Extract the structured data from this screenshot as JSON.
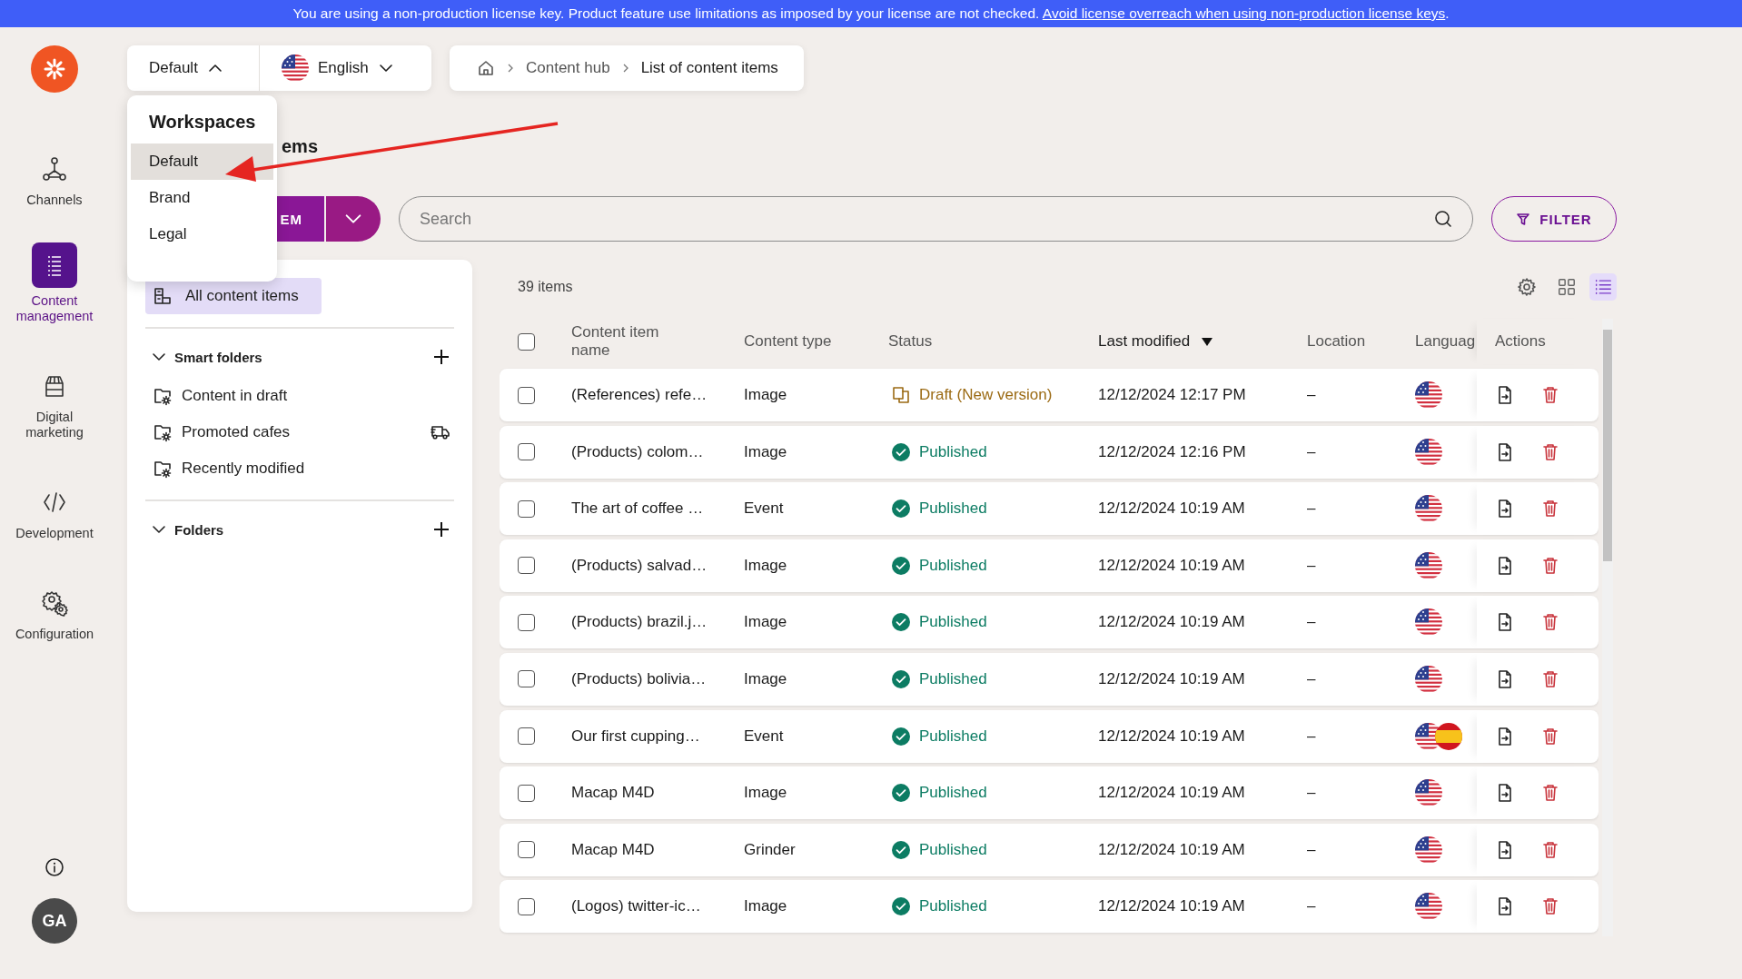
{
  "banner": {
    "text": "You are using a non-production license key. Product feature use limitations as imposed by your license are not checked.",
    "link": "Avoid license overreach when using non-production license keys",
    "after": "."
  },
  "nav": {
    "items": [
      {
        "kind": "channels",
        "label": "Channels",
        "selected": false
      },
      {
        "kind": "content",
        "label": "Content management",
        "selected": true
      },
      {
        "kind": "marketing",
        "label": "Digital marketing",
        "selected": false
      },
      {
        "kind": "development",
        "label": "Development",
        "selected": false
      },
      {
        "kind": "configuration",
        "label": "Configuration",
        "selected": false
      }
    ],
    "avatar": "GA"
  },
  "workspace_switcher": {
    "label": "Default",
    "expanded": true
  },
  "language_switcher": {
    "label": "English",
    "flag": {
      "kind": "us"
    },
    "expanded": false
  },
  "breadcrumb": [
    {
      "kind": "home"
    },
    {
      "kind": "link",
      "label": "Content hub"
    },
    {
      "kind": "current",
      "label": "List of content items"
    }
  ],
  "workspace_menu": {
    "title": "Workspaces",
    "items": [
      {
        "label": "Default",
        "selected": true
      },
      {
        "label": "Brand",
        "selected": false
      },
      {
        "label": "Legal",
        "selected": false
      }
    ]
  },
  "page_title": "ems",
  "new_button": {
    "label": "EM"
  },
  "search": {
    "placeholder": "Search"
  },
  "filter_button": {
    "label": "FILTER"
  },
  "tree": {
    "all_items": {
      "label": "All content items",
      "selected": true
    },
    "sections": [
      {
        "title": "Smart folders",
        "expanded": true,
        "items": [
          {
            "label": "Content in draft",
            "extra_icon": false
          },
          {
            "label": "Promoted cafes",
            "extra_icon": true
          },
          {
            "label": "Recently modified",
            "extra_icon": false
          }
        ]
      },
      {
        "title": "Folders",
        "expanded": true
      }
    ]
  },
  "list": {
    "count": "39 items",
    "views": [
      {
        "kind": "grid",
        "selected": false
      },
      {
        "kind": "list",
        "selected": true
      }
    ],
    "select_all": {
      "checked": false
    },
    "columns": [
      {
        "label": "Content item name"
      },
      {
        "label": "Content type"
      },
      {
        "label": "Status"
      },
      {
        "label": "Last modified",
        "sorted": true,
        "descending": true
      },
      {
        "label": "Location"
      },
      {
        "label": "Languag"
      },
      {
        "label": "Actions"
      }
    ],
    "rows": [
      {
        "checked": false,
        "name": "(References) refe…",
        "type": "Image",
        "status": {
          "kind": "draft",
          "label": "Draft (New version)"
        },
        "modified": "12/12/2024 12:17 PM",
        "location": "–",
        "languages": [
          {
            "kind": "us"
          }
        ]
      },
      {
        "checked": false,
        "name": "(Products) colom…",
        "type": "Image",
        "status": {
          "kind": "published",
          "label": "Published"
        },
        "modified": "12/12/2024 12:16 PM",
        "location": "–",
        "languages": [
          {
            "kind": "us"
          }
        ]
      },
      {
        "checked": false,
        "name": "The art of coffee …",
        "type": "Event",
        "status": {
          "kind": "published",
          "label": "Published"
        },
        "modified": "12/12/2024 10:19 AM",
        "location": "–",
        "languages": [
          {
            "kind": "us"
          }
        ]
      },
      {
        "checked": false,
        "name": "(Products) salvad…",
        "type": "Image",
        "status": {
          "kind": "published",
          "label": "Published"
        },
        "modified": "12/12/2024 10:19 AM",
        "location": "–",
        "languages": [
          {
            "kind": "us"
          }
        ]
      },
      {
        "checked": false,
        "name": "(Products) brazil.j…",
        "type": "Image",
        "status": {
          "kind": "published",
          "label": "Published"
        },
        "modified": "12/12/2024 10:19 AM",
        "location": "–",
        "languages": [
          {
            "kind": "us"
          }
        ]
      },
      {
        "checked": false,
        "name": "(Products) bolivia…",
        "type": "Image",
        "status": {
          "kind": "published",
          "label": "Published"
        },
        "modified": "12/12/2024 10:19 AM",
        "location": "–",
        "languages": [
          {
            "kind": "us"
          }
        ]
      },
      {
        "checked": false,
        "name": "Our first cupping…",
        "type": "Event",
        "status": {
          "kind": "published",
          "label": "Published"
        },
        "modified": "12/12/2024 10:19 AM",
        "location": "–",
        "languages": [
          {
            "kind": "us"
          },
          {
            "kind": "es"
          }
        ]
      },
      {
        "checked": false,
        "name": "Macap M4D",
        "type": "Image",
        "status": {
          "kind": "published",
          "label": "Published"
        },
        "modified": "12/12/2024 10:19 AM",
        "location": "–",
        "languages": [
          {
            "kind": "us"
          }
        ]
      },
      {
        "checked": false,
        "name": "Macap M4D",
        "type": "Grinder",
        "status": {
          "kind": "published",
          "label": "Published"
        },
        "modified": "12/12/2024 10:19 AM",
        "location": "–",
        "languages": [
          {
            "kind": "us"
          }
        ]
      },
      {
        "checked": false,
        "name": "(Logos) twitter-ic…",
        "type": "Image",
        "status": {
          "kind": "published",
          "label": "Published"
        },
        "modified": "12/12/2024 10:19 AM",
        "location": "–",
        "languages": [
          {
            "kind": "us"
          }
        ]
      }
    ]
  }
}
